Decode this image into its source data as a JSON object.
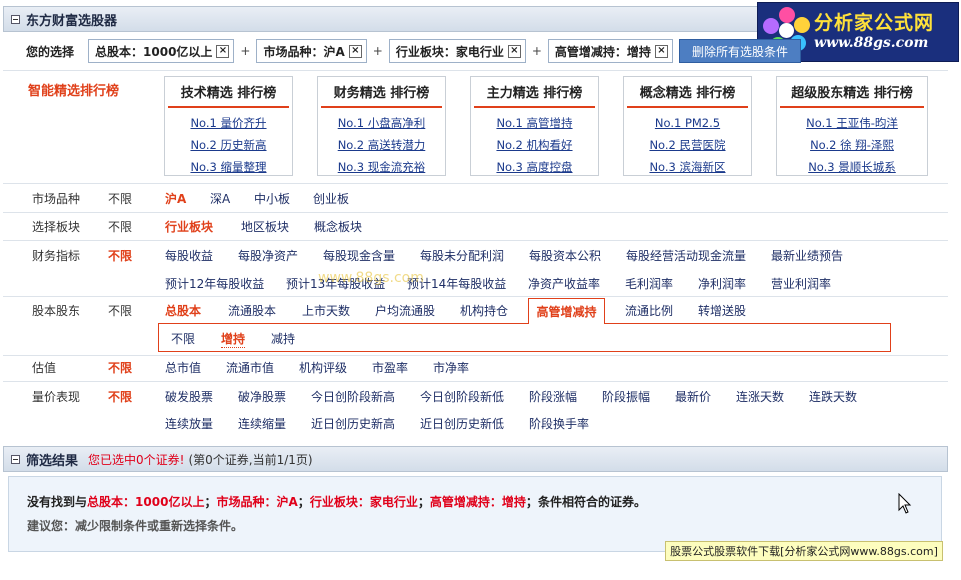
{
  "header": {
    "title": "东方财富选股器"
  },
  "logo": {
    "name": "分析家公式网",
    "url": "www.88gs.com"
  },
  "selection": {
    "label": "您的选择",
    "chips": [
      {
        "text": "总股本：1000亿以上"
      },
      {
        "text": "市场品种：沪A"
      },
      {
        "text": "行业板块：家电行业"
      },
      {
        "text": "高管增减持：增持"
      }
    ],
    "plus": "+",
    "remove_glyph": "×",
    "clear_label": "删除所有选股条件"
  },
  "rankings": {
    "title": "智能精选排行榜",
    "boxes": [
      {
        "title": "技术精选 排行榜",
        "items": [
          "No.1 量价齐升",
          "No.2 历史新高",
          "No.3 缩量整理"
        ]
      },
      {
        "title": "财务精选 排行榜",
        "items": [
          "No.1 小盘高净利",
          "No.2 高送转潜力",
          "No.3 现金流充裕"
        ]
      },
      {
        "title": "主力精选 排行榜",
        "items": [
          "No.1 高管增持",
          "No.2 机构看好",
          "No.3 高度控盘"
        ]
      },
      {
        "title": "概念精选 排行榜",
        "items": [
          "No.1 PM2.5",
          "No.2 民营医院",
          "No.3 滨海新区"
        ]
      },
      {
        "title": "超级股东精选 排行榜",
        "items": [
          "No.1 王亚伟-昀洋",
          "No.2 徐 翔-泽熙",
          "No.3 景顺长城系"
        ]
      }
    ]
  },
  "filters": {
    "market": {
      "label": "市场品种",
      "any": "不限",
      "options": [
        "沪A",
        "深A",
        "中小板",
        "创业板"
      ]
    },
    "sector": {
      "label": "选择板块",
      "any": "不限",
      "options": [
        "行业板块",
        "地区板块",
        "概念板块"
      ]
    },
    "finance": {
      "label": "财务指标",
      "any": "不限",
      "row1": [
        "每股收益",
        "每股净资产",
        "每股现金含量",
        "每股未分配利润",
        "每股资本公积",
        "每股经营活动现金流量",
        "最新业绩预告"
      ],
      "row2": [
        "预计12年每股收益",
        "预计13年每股收益",
        "预计14年每股收益",
        "净资产收益率",
        "毛利润率",
        "净利润率",
        "营业利润率"
      ]
    },
    "equity": {
      "label": "股本股东",
      "any": "不限",
      "options": [
        "总股本",
        "流通股本",
        "上市天数",
        "户均流通股",
        "机构持仓",
        "高管增减持",
        "流通比例",
        "转增送股"
      ],
      "sub": [
        "不限",
        "增持",
        "减持"
      ]
    },
    "valuation": {
      "label": "估值",
      "any": "不限",
      "options": [
        "总市值",
        "流通市值",
        "机构评级",
        "市盈率",
        "市净率"
      ]
    },
    "price": {
      "label": "量价表现",
      "any": "不限",
      "row1": [
        "破发股票",
        "破净股票",
        "今日创阶段新高",
        "今日创阶段新低",
        "阶段涨幅",
        "阶段振幅",
        "最新价",
        "连涨天数",
        "连跌天数"
      ],
      "row2": [
        "连续放量",
        "连续缩量",
        "近日创历史新高",
        "近日创历史新低",
        "阶段换手率"
      ]
    }
  },
  "results": {
    "title": "筛选结果",
    "note": "您已选中0个证券!",
    "count": "(第0个证券,当前1/1页)",
    "line1_prefix": "没有找到与",
    "line1_conditions": [
      {
        "key": "总股本",
        "sep": "：",
        "value": "1000亿以上"
      },
      {
        "key": "市场品种",
        "sep": "：",
        "value": "沪A"
      },
      {
        "key": "行业板块",
        "sep": "：",
        "value": "家电行业"
      },
      {
        "key": "高管增减持",
        "sep": "：",
        "value": "增持"
      }
    ],
    "line1_suffix": "条件相符合的证券。",
    "line2": "建议您：减少限制条件或重新选择条件。"
  },
  "watermark": "www.88gs.com",
  "footer": {
    "text": "股票公式股票软件下载[分析家公式网www.88gs.com]"
  },
  "colors": {
    "accent": "#e0401a",
    "link": "#1b3a8c",
    "header_bg": "#d3dde9",
    "result_bg": "#eef4fb"
  }
}
